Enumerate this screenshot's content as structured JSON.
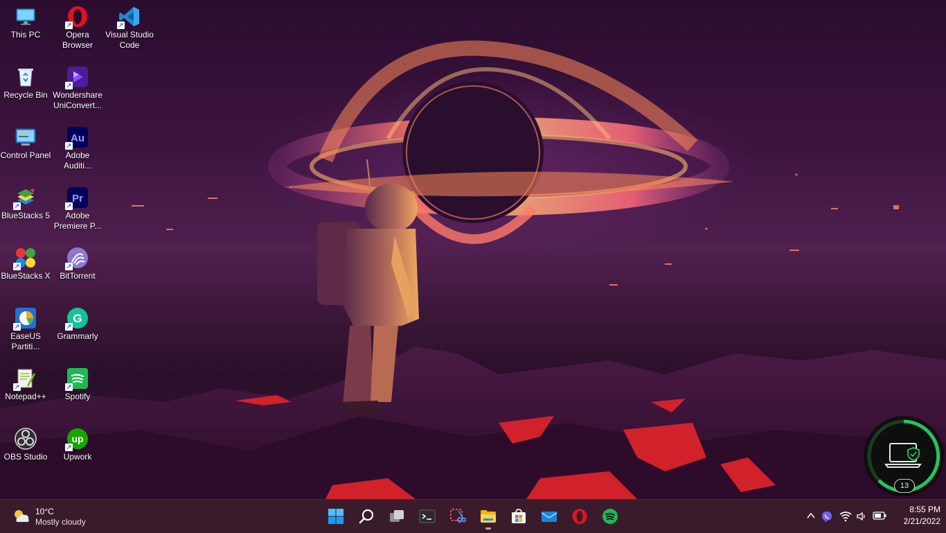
{
  "desktop_icons": [
    {
      "label": "This PC",
      "icon": "monitor-icon"
    },
    {
      "label": "Opera Browser",
      "icon": "opera-icon"
    },
    {
      "label": "Visual Studio Code",
      "icon": "vscode-icon"
    },
    {
      "label": "Recycle Bin",
      "icon": "recycle-bin-icon"
    },
    {
      "label": "Wondershare UniConvert...",
      "icon": "uniconverter-icon"
    },
    {
      "label": "Control Panel",
      "icon": "control-panel-icon"
    },
    {
      "label": "Adobe Auditi...",
      "icon": "audition-icon",
      "glyph": "Au"
    },
    {
      "label": "BlueStacks 5",
      "icon": "bluestacks-5-icon"
    },
    {
      "label": "Adobe Premiere P...",
      "icon": "premiere-icon",
      "glyph": "Pr"
    },
    {
      "label": "BlueStacks X",
      "icon": "bluestacks-x-icon"
    },
    {
      "label": "BitTorrent",
      "icon": "bittorrent-icon"
    },
    {
      "label": "EaseUS Partiti...",
      "icon": "easeus-icon"
    },
    {
      "label": "Grammarly",
      "icon": "grammarly-icon",
      "glyph": "G"
    },
    {
      "label": "Notepad++",
      "icon": "notepad-plus-plus-icon"
    },
    {
      "label": "Spotify",
      "icon": "spotify-icon"
    },
    {
      "label": "OBS Studio",
      "icon": "obs-icon"
    },
    {
      "label": "Upwork",
      "icon": "upwork-icon",
      "glyph": "up"
    }
  ],
  "widget": {
    "count": "13",
    "icon": "laptop-shield-icon",
    "ring_color": "#22c55e"
  },
  "weather": {
    "temperature": "10°C",
    "condition": "Mostly cloudy",
    "icon": "partly-cloudy-icon"
  },
  "taskbar_apps": [
    {
      "name": "start-button",
      "icon": "windows-logo-icon"
    },
    {
      "name": "search-button",
      "icon": "search-icon"
    },
    {
      "name": "task-view-button",
      "icon": "task-view-icon"
    },
    {
      "name": "terminal-button",
      "icon": "terminal-icon"
    },
    {
      "name": "snipping-tool-button",
      "icon": "snipping-tool-icon"
    },
    {
      "name": "file-explorer-button",
      "icon": "folder-icon",
      "running": true
    },
    {
      "name": "microsoft-store-button",
      "icon": "store-icon"
    },
    {
      "name": "mail-button",
      "icon": "mail-icon"
    },
    {
      "name": "opera-button",
      "icon": "opera-icon"
    },
    {
      "name": "spotify-button",
      "icon": "spotify-icon"
    }
  ],
  "tray": [
    "chevron-up-icon",
    "viber-icon",
    "wifi-icon",
    "volume-icon",
    "battery-icon"
  ],
  "clock": {
    "time": "8:55 PM",
    "date": "2/21/2022"
  },
  "colors": {
    "taskbar": "#3a1b2c",
    "accent_orange": "#ff7a3d",
    "lava": "#e3242b"
  }
}
